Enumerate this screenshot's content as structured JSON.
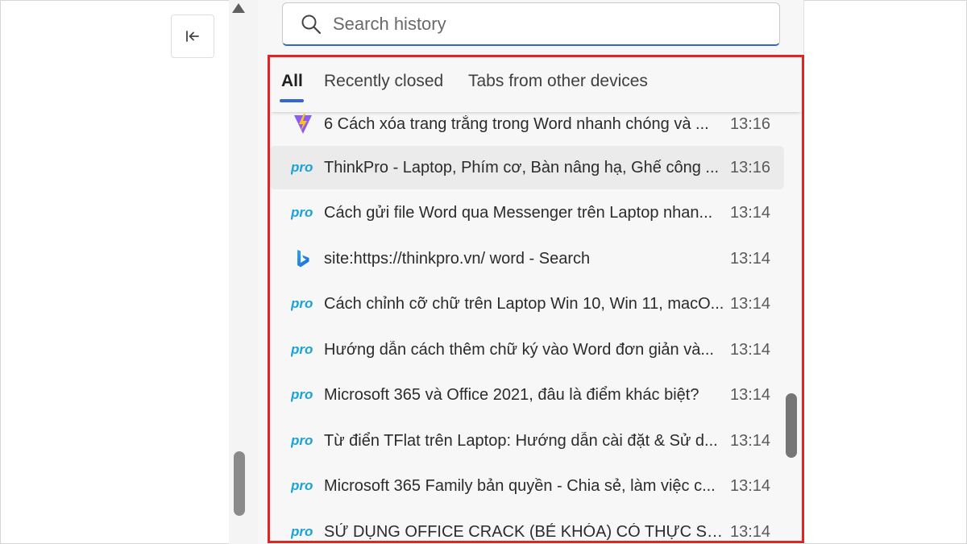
{
  "sidebar": {
    "collapse_icon": "collapse-left-icon"
  },
  "search": {
    "placeholder": "Search history",
    "icon": "search-icon"
  },
  "tabs": [
    {
      "label": "All",
      "active": true
    },
    {
      "label": "Recently closed",
      "active": false
    },
    {
      "label": "Tabs from other devices",
      "active": false
    }
  ],
  "history": [
    {
      "title": "6 Cách xóa trang trắng trong Word nhanh chóng và ...",
      "time": "13:16",
      "icon": "bolt-favicon"
    },
    {
      "title": "ThinkPro - Laptop, Phím cơ, Bàn nâng hạ, Ghế công ...",
      "time": "13:16",
      "icon": "thinkpro-favicon"
    },
    {
      "title": "Cách gửi file Word qua Messenger trên Laptop nhan...",
      "time": "13:14",
      "icon": "thinkpro-favicon"
    },
    {
      "title": "site:https://thinkpro.vn/ word - Search",
      "time": "13:14",
      "icon": "bing-favicon"
    },
    {
      "title": "Cách chỉnh cỡ chữ trên Laptop Win 10, Win 11, macO...",
      "time": "13:14",
      "icon": "thinkpro-favicon"
    },
    {
      "title": "Hướng dẫn cách thêm chữ ký vào Word đơn giản và...",
      "time": "13:14",
      "icon": "thinkpro-favicon"
    },
    {
      "title": "Microsoft 365 và Office 2021, đâu là điểm khác biệt?",
      "time": "13:14",
      "icon": "thinkpro-favicon"
    },
    {
      "title": "Từ điển TFlat trên Laptop: Hướng dẫn cài đặt & Sử d...",
      "time": "13:14",
      "icon": "thinkpro-favicon"
    },
    {
      "title": "Microsoft 365 Family bản quyền - Chia sẻ, làm việc c...",
      "time": "13:14",
      "icon": "thinkpro-favicon"
    },
    {
      "title": "SỬ DỤNG OFFICE CRACK (BẺ KHÓA) CÓ THỰC SỰ L...",
      "time": "13:14",
      "icon": "thinkpro-favicon"
    }
  ],
  "colors": {
    "accent": "#3266d0",
    "highlight": "#e02424",
    "thinkpro": "#1aa3d9"
  }
}
